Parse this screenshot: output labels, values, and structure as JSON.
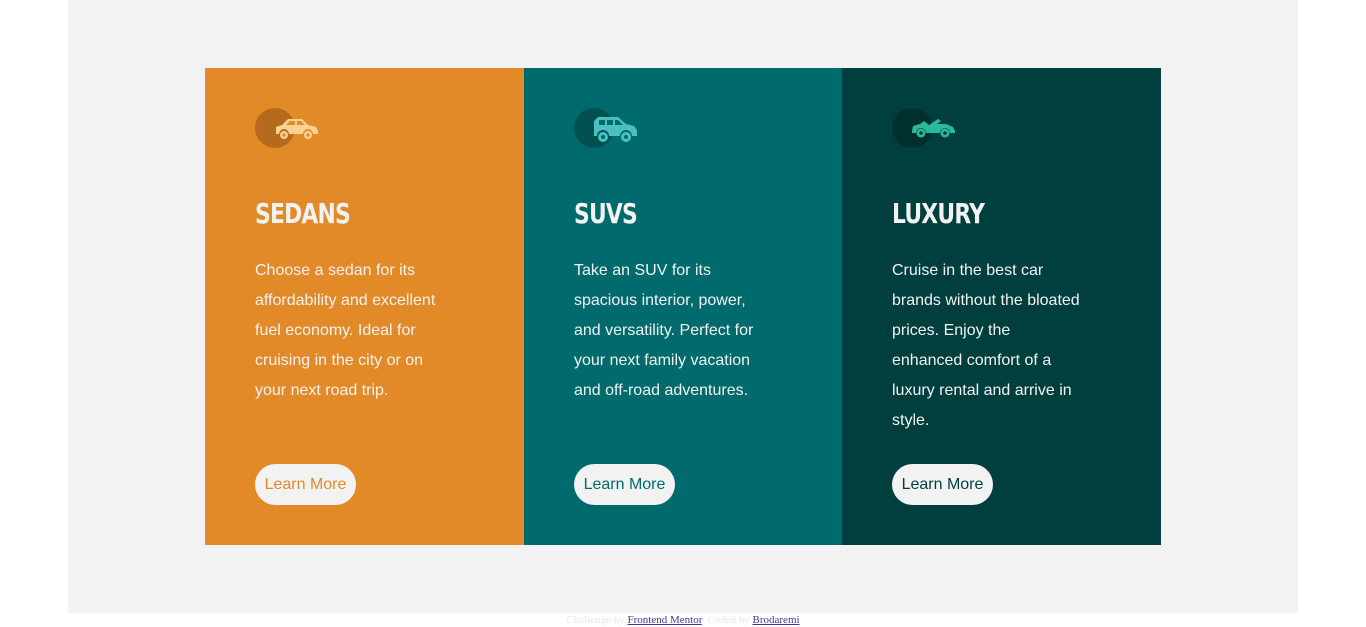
{
  "cards": [
    {
      "icon": "sedan-icon",
      "title": "SEDANS",
      "description": "Choose a sedan for its affordability and excellent fuel economy. Ideal for cruising in the city or on your next road trip.",
      "button": "Learn More",
      "color": "#e28a28"
    },
    {
      "icon": "suv-icon",
      "title": "SUVS",
      "description": "Take an SUV for its spacious interior, power, and versatility. Perfect for your next family vacation and off-road adventures.",
      "button": "Learn More",
      "color": "#006a6c"
    },
    {
      "icon": "luxury-car-icon",
      "title": "LUXURY",
      "description": "Cruise in the best car brands without the bloated prices. Enjoy the enhanced comfort of a luxury rental and arrive in style.",
      "button": "Learn More",
      "color": "#013f3f"
    }
  ],
  "footer": {
    "challenge_prefix": "Challenge by",
    "challenge_link": "Frontend Mentor",
    "coded_prefix": ". Coded by",
    "coded_link": "Brodaremi"
  },
  "colors": {
    "background": "#f2f2f2",
    "text_light": "#f2f2f2",
    "sedan_icon": "#f9d291",
    "suv_icon": "#4ac0c0",
    "luxury_icon": "#2ab99a"
  }
}
